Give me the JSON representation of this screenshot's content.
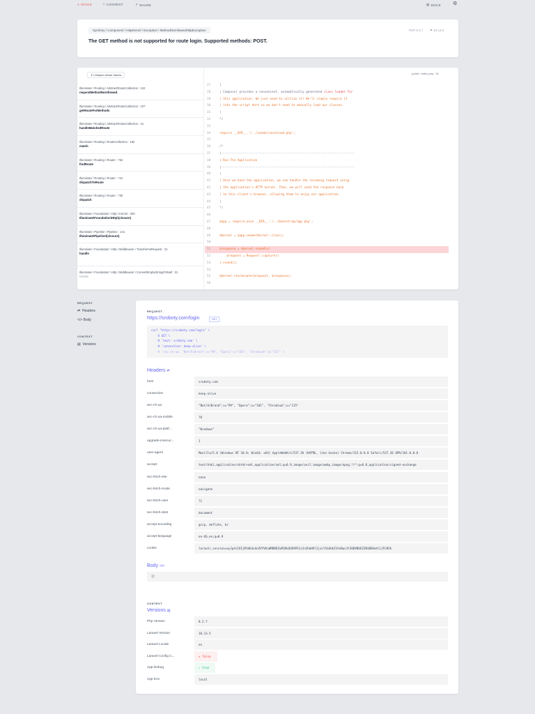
{
  "nav": {
    "stack": "STACK",
    "context": "CONTEXT",
    "share": "SHARE",
    "docs": "DOCS"
  },
  "exception": {
    "class": "Symfony \\ Component \\ HttpKernel \\ Exception \\ MethodNotAllowedHttpException",
    "message": "The GET method is not supported for route login. Supported methods: POST.",
    "php": "PHP 8.2.7",
    "time": "10.13.5"
  },
  "stack": {
    "collapse": "Collapse vendor frames",
    "file": "public / index.php : 51",
    "frames": [
      {
        "cls": "Illuminate \\ Routing \\ AbstractRouteCollection : 122",
        "fn": "requestMethodNotAllowed"
      },
      {
        "cls": "Illuminate \\ Routing \\ AbstractRouteCollection : 107",
        "fn": "getRouteForMethods"
      },
      {
        "cls": "Illuminate \\ Routing \\ AbstractRouteCollection : 41",
        "fn": "handleMatchedRoute"
      },
      {
        "cls": "Illuminate \\ Routing \\ RouteCollection : 162",
        "fn": "match"
      },
      {
        "cls": "Illuminate \\ Routing \\ Router : 754",
        "fn": "findRoute"
      },
      {
        "cls": "Illuminate \\ Routing \\ Router : 741",
        "fn": "dispatchToRoute"
      },
      {
        "cls": "Illuminate \\ Routing \\ Router : 730",
        "fn": "dispatch"
      },
      {
        "cls": "Illuminate \\ Foundation \\ Http \\ Kernel : 200",
        "fn": "Illuminate\\Foundation\\Http\\{closure}"
      },
      {
        "cls": "Illuminate \\ Pipeline \\ Pipeline : 141",
        "fn": "Illuminate\\Pipeline\\{closure}"
      },
      {
        "cls": "Illuminate \\ Foundation \\ Http \\ Middleware \\ TransformsRequest : 21",
        "fn": "handle"
      },
      {
        "cls": "Illuminate \\ Foundation \\ Http \\ Middleware \\ ConvertEmptyStringsToNull : 31",
        "fn": "handle"
      }
    ],
    "code": [
      {
        "n": "27",
        "t": "|",
        "c": "g"
      },
      {
        "n": "28",
        "t": "| Composer provides a convenient, automatically generated ",
        "c": "g",
        "t2": "class loader for"
      },
      {
        "n": "29",
        "t": "| this application. We just need to utilize it! We'll simply require it",
        "c": "o"
      },
      {
        "n": "30",
        "t": "| into the script here so we don't need to manually load our classes.",
        "c": "o"
      },
      {
        "n": "31",
        "t": "|",
        "c": "g"
      },
      {
        "n": "32",
        "t": "*/",
        "c": "g"
      },
      {
        "n": "33",
        "t": "",
        "c": "g"
      },
      {
        "n": "34",
        "t": "require __DIR__.'/../vendor/autoload.php';",
        "c": "o"
      },
      {
        "n": "35",
        "t": "",
        "c": "g"
      },
      {
        "n": "36",
        "t": "/*",
        "c": "g"
      },
      {
        "n": "37",
        "t": "|--------------------------------------------------------------------------",
        "c": "g"
      },
      {
        "n": "38",
        "t": "| Run The Application",
        "c": "o"
      },
      {
        "n": "39",
        "t": "|--------------------------------------------------------------------------",
        "c": "g"
      },
      {
        "n": "40",
        "t": "|",
        "c": "g"
      },
      {
        "n": "41",
        "t": "| Once we have the application, we can handle the incoming request using",
        "c": "o"
      },
      {
        "n": "42",
        "t": "| the application's HTTP kernel. Then, we will send the response back",
        "c": "o"
      },
      {
        "n": "43",
        "t": "| to this client's browser, allowing them to enjoy our application.",
        "c": "o"
      },
      {
        "n": "44",
        "t": "|",
        "c": "g"
      },
      {
        "n": "45",
        "t": "*/",
        "c": "g"
      },
      {
        "n": "46",
        "t": "",
        "c": "g"
      },
      {
        "n": "47",
        "t": "$app = require_once __DIR__.'/../bootstrap/app.php';",
        "c": "o"
      },
      {
        "n": "48",
        "t": "",
        "c": "g"
      },
      {
        "n": "49",
        "t": "$kernel = $app->make(Kernel::class);",
        "c": "o"
      },
      {
        "n": "50",
        "t": "",
        "c": "g"
      },
      {
        "n": "51",
        "t": "$response = $kernel->handle(",
        "c": "o"
      },
      {
        "n": "52",
        "t": "    $request = Request::capture()",
        "c": "o"
      },
      {
        "n": "53",
        "t": ")->send();",
        "c": "o"
      },
      {
        "n": "54",
        "t": "",
        "c": "g"
      },
      {
        "n": "55",
        "t": "$kernel->terminate($request, $response);",
        "c": "o"
      },
      {
        "n": "56",
        "t": "",
        "c": "g"
      }
    ],
    "highlight_line": "51"
  },
  "sidenav": {
    "request": "REQUEST",
    "headers": "Headers",
    "body": "Body",
    "context": "CONTEXT",
    "versions": "Versions"
  },
  "request": {
    "label": "REQUEST",
    "url": "https://sroboty.com/login",
    "method": "GET",
    "curl": [
      "curl \"https://sroboty.com/login\" \\",
      "   -X GET \\",
      "   -H 'host: sroboty.com' \\",
      "   -H 'connection: keep-alive' \\",
      "   -H 'sec-ch-ua: \"Not/A)Brand\";v=\"99\", \"Opera\";v=\"101\", \"Chromium\";v=\"115\"' \\"
    ],
    "headers_title": "Headers",
    "headers": [
      {
        "k": "host",
        "v": "sroboty.com"
      },
      {
        "k": "connection",
        "v": "keep-alive"
      },
      {
        "k": "sec-ch-ua",
        "v": "\"Not/A)Brand\";v=\"99\", \"Opera\";v=\"101\", \"Chromium\";v=\"115\""
      },
      {
        "k": "sec-ch-ua-mobile",
        "v": "?0"
      },
      {
        "k": "sec-ch-ua-platf...",
        "v": "\"Windows\""
      },
      {
        "k": "upgrade-insecur...",
        "v": "1"
      },
      {
        "k": "user-agent",
        "v": "Mozilla/5.0 (Windows NT 10.0; Win64; x64) AppleWebKit/537.36 (KHTML, like Gecko) Chrome/115.0.0.0 Safari/537.36 OPR/101.0.0.0"
      },
      {
        "k": "accept",
        "v": "text/html,application/xhtml+xml,application/xml;q=0.9,image/avif,image/webp,image/apng,*/*;q=0.8,application/signed-exchange"
      },
      {
        "k": "sec-fetch-site",
        "v": "none"
      },
      {
        "k": "sec-fetch-mode",
        "v": "navigate"
      },
      {
        "k": "sec-fetch-user",
        "v": "?1"
      },
      {
        "k": "sec-fetch-dest",
        "v": "document"
      },
      {
        "k": "accept-encoding",
        "v": "gzip, deflate, br"
      },
      {
        "k": "accept-language",
        "v": "en-US,en;q=0.9"
      },
      {
        "k": "cookie",
        "v": "laravel_session=eyJpdiI6IjM3dEdzdnZVYVUcWRBRDZuM1RkOUE9PSIsInZhbHVlIjoiY1h6UkZ1VnBwc1Y3UDVBUEZ2N1BBSmtCL2FLM2h"
      }
    ],
    "body_title": "Body",
    "body": "[]"
  },
  "context": {
    "label": "CONTEXT",
    "versions_title": "Versions",
    "versions": [
      {
        "k": "Php Version",
        "v": "8.2.7"
      },
      {
        "k": "Laravel Version",
        "v": "10.13.5"
      },
      {
        "k": "Laravel Locale",
        "v": "en"
      },
      {
        "k": "Laravel Config C...",
        "v": "false",
        "type": "false"
      },
      {
        "k": "App Debug",
        "v": "true",
        "type": "true"
      },
      {
        "k": "App Env",
        "v": "local"
      }
    ]
  },
  "colors": {
    "accent": "#6366f1",
    "error": "#ef4444",
    "highlight": "#fbd5d7",
    "code": "#e8742c"
  }
}
